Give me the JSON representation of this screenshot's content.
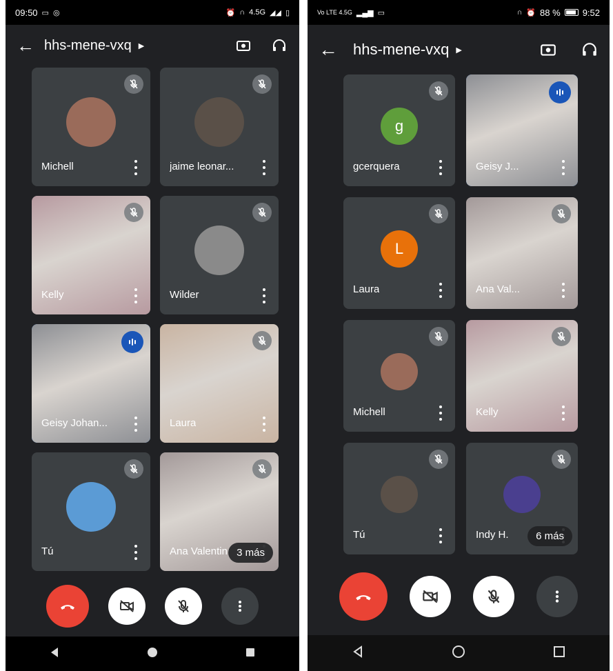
{
  "left": {
    "status": {
      "time": "09:50",
      "network": "4.5G"
    },
    "meeting_title": "hhs-mene-vxq",
    "tiles": [
      {
        "name": "Michell",
        "muted": true,
        "kind": "avatar",
        "color": "#9a6b5a"
      },
      {
        "name": "jaime leonar...",
        "muted": true,
        "kind": "avatar",
        "color": "#5a5048"
      },
      {
        "name": "Kelly",
        "muted": true,
        "kind": "video",
        "color": "#b79aa0"
      },
      {
        "name": "Wilder",
        "muted": true,
        "kind": "avatar",
        "color": "#8a8a8a"
      },
      {
        "name": "Geisy Johan...",
        "muted": false,
        "speaking": true,
        "kind": "video",
        "color": "#8d8f94"
      },
      {
        "name": "Laura",
        "muted": true,
        "kind": "video",
        "color": "#c9b4a2"
      },
      {
        "name": "Tú",
        "muted": true,
        "kind": "avatar",
        "color": "#5b9bd5"
      },
      {
        "name": "Ana Valentin",
        "muted": true,
        "kind": "video",
        "color": "#a39999",
        "more": "3 más"
      }
    ],
    "nav": [
      "back-nav",
      "home-nav",
      "recents-nav"
    ]
  },
  "right": {
    "status": {
      "carrier": "Vo LTE 4.5G",
      "battery": "88 %",
      "time": "9:52"
    },
    "meeting_title": "hhs-mene-vxq",
    "tiles": [
      {
        "name": "gcerquera",
        "muted": true,
        "kind": "letter",
        "letter": "g",
        "color": "#5f9e3b"
      },
      {
        "name": "Geisy J...",
        "muted": false,
        "speaking": true,
        "kind": "video",
        "color": "#8d8f94"
      },
      {
        "name": "Laura",
        "muted": true,
        "kind": "letter",
        "letter": "L",
        "color": "#e8710a"
      },
      {
        "name": "Ana Val...",
        "muted": true,
        "kind": "video",
        "color": "#a39999"
      },
      {
        "name": "Michell",
        "muted": true,
        "kind": "avatar",
        "color": "#9a6b5a"
      },
      {
        "name": "Kelly",
        "muted": true,
        "kind": "video",
        "color": "#b79aa0"
      },
      {
        "name": "Tú",
        "muted": true,
        "kind": "avatar",
        "color": "#5a5048"
      },
      {
        "name": "Indy H.",
        "muted": true,
        "kind": "avatar",
        "color": "#4a3f8f",
        "more": "6 más"
      }
    ],
    "nav": [
      "back-nav",
      "home-nav",
      "recents-nav"
    ]
  },
  "colors": {
    "end_call": "#ea4335",
    "speaking_border": "#1a73e8",
    "tile_bg": "#3c4043"
  }
}
